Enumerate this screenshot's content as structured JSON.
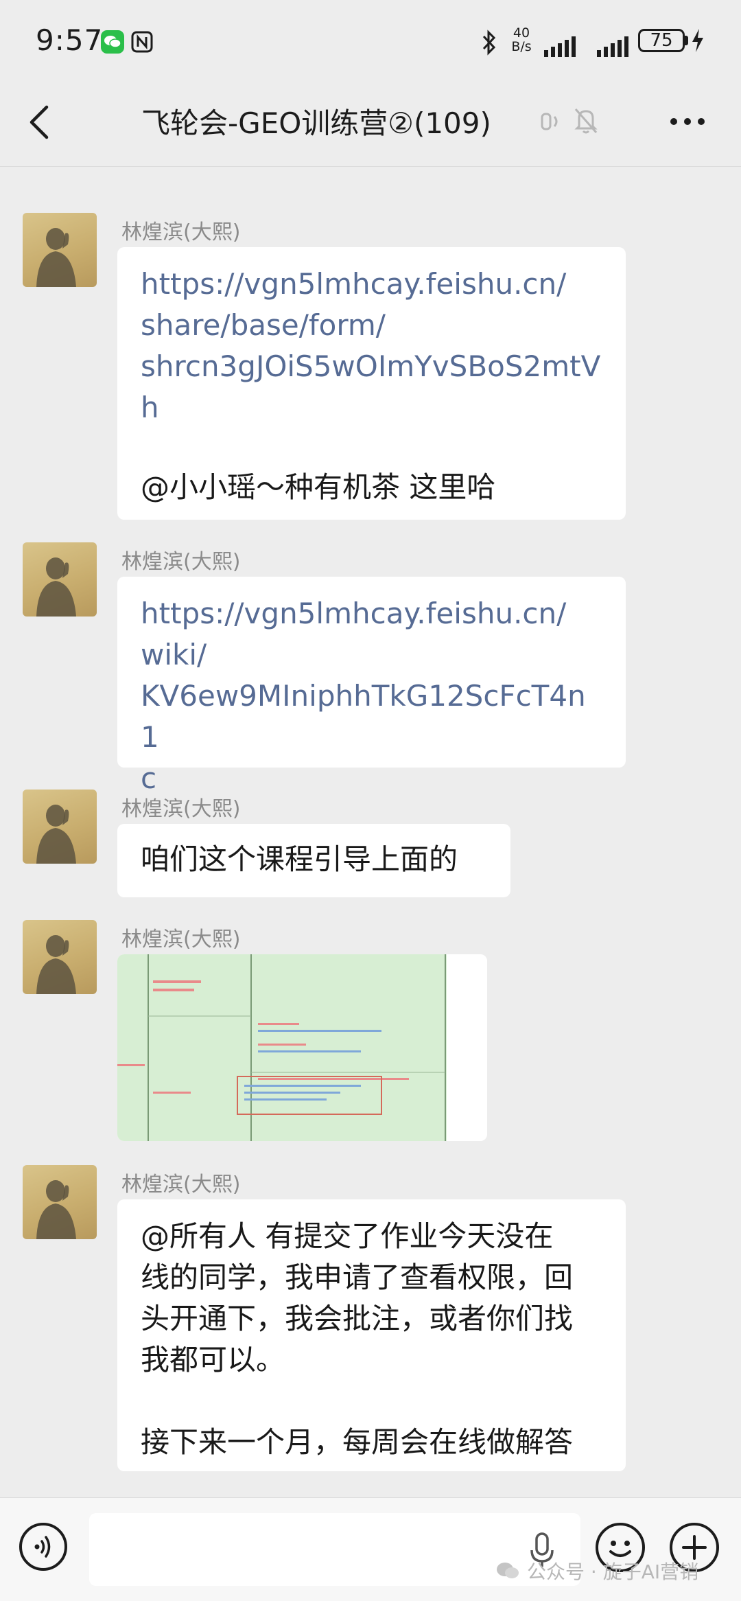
{
  "status_bar": {
    "time": "9:57",
    "net_speed_value": "40",
    "net_speed_unit": "B/s",
    "battery": "75"
  },
  "header": {
    "title": "飞轮会-GEO训练营②(109)"
  },
  "messages": [
    {
      "sender": "林煌滨(大熙)",
      "link_lines": [
        "https://vgn5lmhcay.feishu.cn/",
        "share/base/form/",
        "shrcn3gJOiS5wOImYvSBoS2mtV",
        "h"
      ],
      "text": " @小小瑶～种有机茶  这里哈"
    },
    {
      "sender": "林煌滨(大熙)",
      "link_lines": [
        "https://vgn5lmhcay.feishu.cn/",
        "wiki/",
        "KV6ew9MIniphhTkG12ScFcT4n1",
        "c"
      ]
    },
    {
      "sender": "林煌滨(大熙)",
      "text": "咱们这个课程引导上面的"
    },
    {
      "sender": "林煌滨(大熙)",
      "image": "screenshot-thumbnail"
    },
    {
      "sender": "林煌滨(大熙)",
      "text_lines": [
        "@所有人  有提交了作业今天没在",
        "线的同学，我申请了查看权限，回",
        "头开通下，我会批注，或者你们找",
        "我都可以。"
      ],
      "text_after_gap": "接下来一个月，每周会在线做解答"
    }
  ],
  "input_bar": {
    "placeholder": ""
  },
  "watermark": {
    "text": "公众号 · 旋子AI营销"
  },
  "icons": {
    "back": "chevron-left-icon",
    "voice": "earpiece-icon",
    "mute": "bell-mute-icon",
    "more": "more-dots-icon",
    "mic": "microphone-icon",
    "emoji": "emoji-icon",
    "plus": "plus-icon"
  },
  "colors": {
    "background": "#ededed",
    "bubble": "#ffffff",
    "link": "#566b94",
    "sender": "#8a8a8a",
    "wechat_green": "#2bbf4a"
  }
}
